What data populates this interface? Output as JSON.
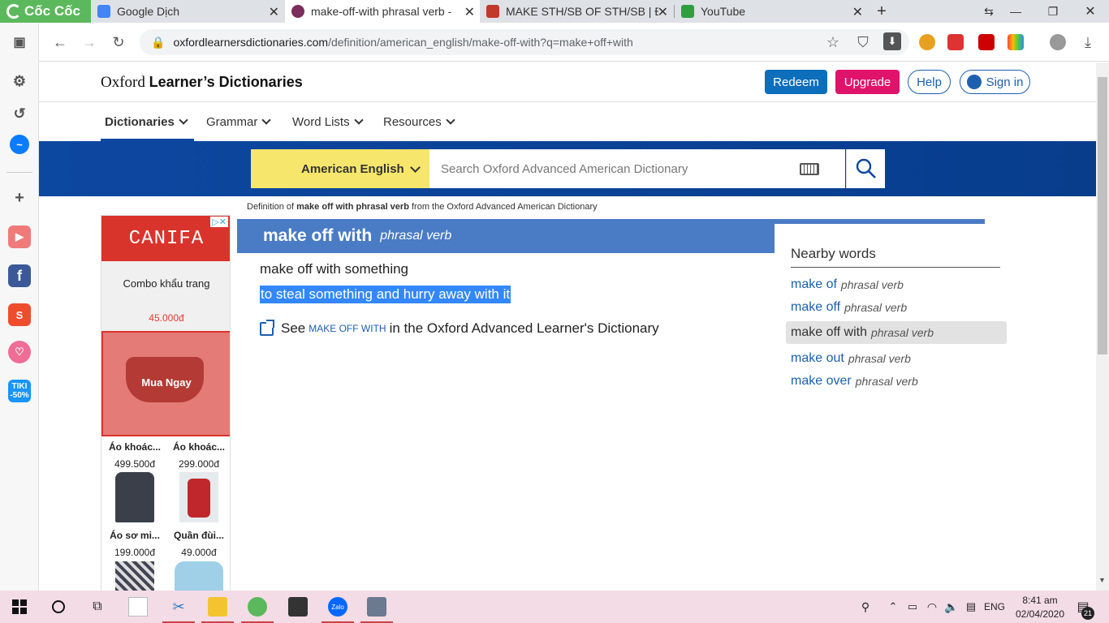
{
  "browser": {
    "brand": "Cốc Cốc",
    "tabs": [
      {
        "title": "Google Dịch",
        "active": false
      },
      {
        "title": "make-off-with phrasal verb -",
        "active": true
      },
      {
        "title": "MAKE STH/SB OF STH/SB | Đị",
        "active": false
      },
      {
        "title": "YouTube",
        "active": false
      }
    ],
    "url_domain": "oxfordlearnersdictionaries.com",
    "url_path": "/definition/american_english/make-off-with?q=make+off+with"
  },
  "site": {
    "logo_plain": "Oxford ",
    "logo_bold": "Learner’s Dictionaries",
    "buttons": {
      "redeem": "Redeem",
      "upgrade": "Upgrade",
      "help": "Help",
      "signin": "Sign in"
    },
    "nav": [
      "Dictionaries",
      "Grammar",
      "Word Lists",
      "Resources"
    ],
    "dict_select": "American English",
    "search_placeholder": "Search Oxford Advanced American Dictionary"
  },
  "breadcrumb": {
    "prefix": "Definition of ",
    "term": "make off with phrasal verb",
    "suffix": " from the Oxford Advanced American Dictionary"
  },
  "entry": {
    "headword": "make off with",
    "pos": "phrasal verb",
    "usage": "make off with something",
    "definition": "to steal something and hurry away with it",
    "see_prefix": "See ",
    "see_link": "make off with",
    "see_suffix": " in the Oxford Advanced Learner's Dictionary"
  },
  "nearby": {
    "title": "Nearby words",
    "items": [
      {
        "word": "make of",
        "pos": "phrasal verb"
      },
      {
        "word": "make off",
        "pos": "phrasal verb"
      },
      {
        "word": "make off with",
        "pos": "phrasal verb"
      },
      {
        "word": "make out",
        "pos": "phrasal verb"
      },
      {
        "word": "make over",
        "pos": "phrasal verb"
      }
    ]
  },
  "ad": {
    "brand": "CANIFA",
    "headline": "Combo khẩu trang",
    "price": "45.000đ",
    "cta": "Mua Ngay",
    "products": [
      {
        "name": "Áo khoác...",
        "price": "499.500đ"
      },
      {
        "name": "Áo khoác...",
        "price": "299.000đ"
      },
      {
        "name": "Áo sơ mi...",
        "price": "199.000đ"
      },
      {
        "name": "Quần đùi...",
        "price": "49.000đ"
      }
    ]
  },
  "sidebar": {
    "tiki": "TIKI -50%"
  },
  "taskbar": {
    "lang": "ENG",
    "time": "8:41 am",
    "date": "02/04/2020",
    "notif": "21"
  },
  "colors": {
    "oxford_blue": "#0c47a0",
    "head_blue": "#4a7bc5",
    "select_yellow": "#f6e66b",
    "upgrade": "#e0136b",
    "redeem": "#0d6ebc"
  }
}
